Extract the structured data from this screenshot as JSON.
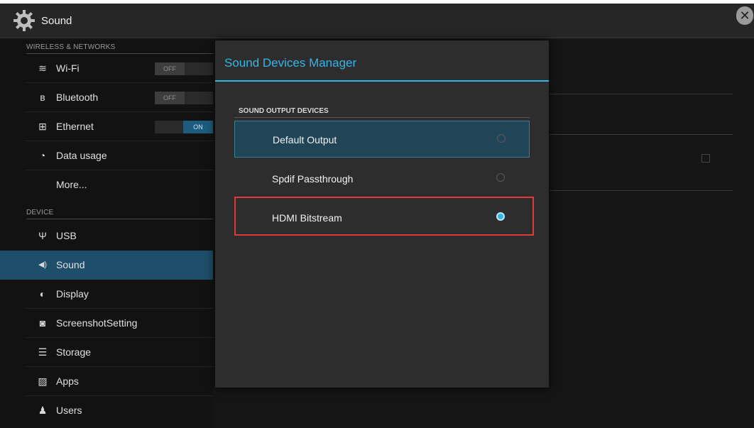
{
  "app": {
    "title": "Sound",
    "icon": "gear-icon",
    "close_icon": "close-icon",
    "close_glyph": "✕"
  },
  "sidebar": {
    "sections": [
      {
        "label": "WIRELESS & NETWORKS"
      },
      {
        "label": "DEVICE"
      }
    ],
    "items": [
      {
        "label": "Wi-Fi",
        "icon": "wifi-icon",
        "glyph": "≋",
        "toggle": "OFF"
      },
      {
        "label": "Bluetooth",
        "icon": "bluetooth-icon",
        "glyph": "ʙ",
        "toggle": "OFF"
      },
      {
        "label": "Ethernet",
        "icon": "ethernet-icon",
        "glyph": "⊞",
        "toggle": "ON"
      },
      {
        "label": "Data usage",
        "icon": "data-usage-icon",
        "glyph": "◔"
      },
      {
        "label": "More..."
      },
      {
        "label": "USB",
        "icon": "usb-icon",
        "glyph": "Ψ"
      },
      {
        "label": "Sound",
        "icon": "speaker-icon",
        "glyph": "◀)"
      },
      {
        "label": "Display",
        "icon": "display-icon",
        "glyph": "◐"
      },
      {
        "label": "ScreenshotSetting",
        "icon": "camera-icon",
        "glyph": "◙"
      },
      {
        "label": "Storage",
        "icon": "storage-icon",
        "glyph": "☰"
      },
      {
        "label": "Apps",
        "icon": "apps-icon",
        "glyph": "▨"
      },
      {
        "label": "Users",
        "icon": "users-icon",
        "glyph": "♟"
      }
    ],
    "selected": "Sound"
  },
  "dialog": {
    "title": "Sound Devices Manager",
    "section": "SOUND OUTPUT DEVICES",
    "options": [
      {
        "label": "Default Output",
        "checked": false,
        "highlighted": true
      },
      {
        "label": "Spdif Passthrough",
        "checked": false,
        "highlighted": false
      },
      {
        "label": "HDMI Bitstream",
        "checked": true,
        "highlighted": false
      }
    ]
  },
  "colors": {
    "accent": "#33b5e5",
    "selection": "#1f4e6a",
    "annotation": "#e03a3a"
  }
}
